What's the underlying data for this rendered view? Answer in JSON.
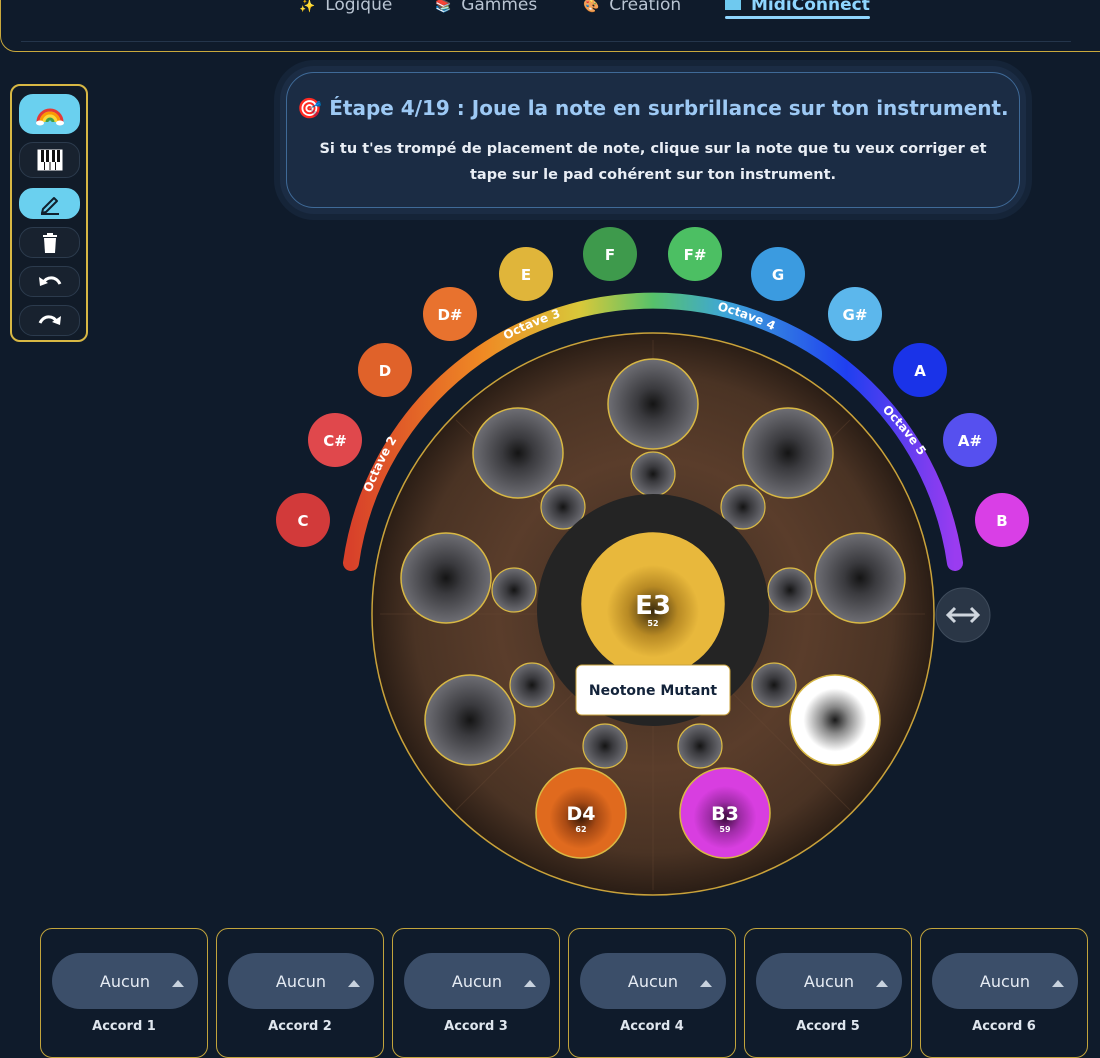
{
  "nav": {
    "tabs": [
      {
        "icon": "✨",
        "label": "Logique"
      },
      {
        "icon": "📚",
        "label": "Gammes"
      },
      {
        "icon": "🎨",
        "label": "Création"
      },
      {
        "icon": "midi-icon",
        "label": "MidiConnect"
      }
    ],
    "active_tab": "MidiConnect"
  },
  "toolbar": {
    "tools": [
      {
        "name": "rainbow-icon",
        "active": true
      },
      {
        "name": "piano-icon",
        "active": false
      },
      {
        "name": "pencil-icon",
        "active": true
      },
      {
        "name": "trash-icon",
        "active": false
      },
      {
        "name": "undo-icon",
        "active": false
      },
      {
        "name": "redo-icon",
        "active": false
      }
    ]
  },
  "banner": {
    "icon": "🎯",
    "title": "Étape 4/19 : Joue la note en surbrillance sur ton instrument.",
    "text": "Si tu t'es trompé de placement de note, clique sur la note que tu veux corriger et tape sur le pad cohérent sur ton instrument."
  },
  "note_buttons": [
    {
      "label": "C",
      "color": "#d23a3a"
    },
    {
      "label": "C#",
      "color": "#e0484c"
    },
    {
      "label": "D",
      "color": "#e0622a"
    },
    {
      "label": "D#",
      "color": "#e8722e"
    },
    {
      "label": "E",
      "color": "#e0b53a"
    },
    {
      "label": "F",
      "color": "#3e9a4c"
    },
    {
      "label": "F#",
      "color": "#4cbf63"
    },
    {
      "label": "G",
      "color": "#3b9be0"
    },
    {
      "label": "G#",
      "color": "#5cb7ec"
    },
    {
      "label": "A",
      "color": "#1a33e8"
    },
    {
      "label": "A#",
      "color": "#5650ef"
    },
    {
      "label": "B",
      "color": "#d93fe6"
    }
  ],
  "octaves": [
    "Octave 2",
    "Octave 3",
    "Octave 4",
    "Octave 5"
  ],
  "instrument": {
    "name": "Neotone Mutant",
    "center": {
      "note": "E3",
      "midi": "52",
      "color": "#e8b83c"
    },
    "assigned_pads": [
      {
        "note": "D4",
        "midi": "62",
        "color": "#e06a1e"
      },
      {
        "note": "B3",
        "midi": "59",
        "color": "#d83ee0"
      }
    ]
  },
  "swap_icon": "left-right-arrow-icon",
  "chords": [
    {
      "value": "Aucun",
      "label": "Accord 1"
    },
    {
      "value": "Aucun",
      "label": "Accord 2"
    },
    {
      "value": "Aucun",
      "label": "Accord 3"
    },
    {
      "value": "Aucun",
      "label": "Accord 4"
    },
    {
      "value": "Aucun",
      "label": "Accord 5"
    },
    {
      "value": "Aucun",
      "label": "Accord 6"
    }
  ]
}
